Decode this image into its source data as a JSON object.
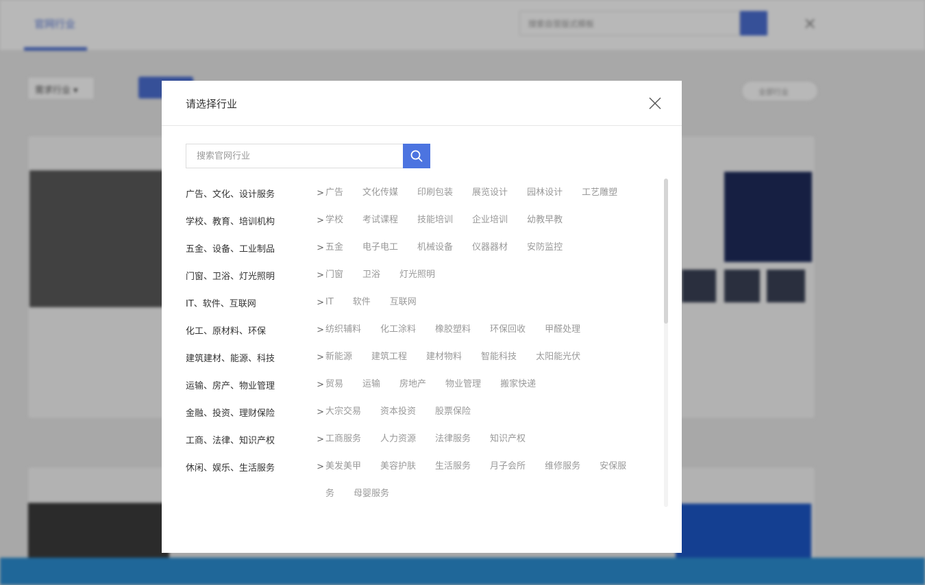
{
  "background": {
    "tab": "官网行业",
    "search_placeholder": "搜索自营版式模板",
    "filter": "需求行业 ▾",
    "pill": "全部行业"
  },
  "modal": {
    "title": "请选择行业",
    "search_placeholder": "搜索官网行业",
    "categories": [
      {
        "label": "广告、文化、设计服务",
        "items": [
          "广告",
          "文化传媒",
          "印刷包装",
          "展览设计",
          "园林设计",
          "工艺雕塑"
        ]
      },
      {
        "label": "学校、教育、培训机构",
        "items": [
          "学校",
          "考试课程",
          "技能培训",
          "企业培训",
          "幼教早教"
        ]
      },
      {
        "label": "五金、设备、工业制品",
        "items": [
          "五金",
          "电子电工",
          "机械设备",
          "仪器器材",
          "安防监控"
        ]
      },
      {
        "label": "门窗、卫浴、灯光照明",
        "items": [
          "门窗",
          "卫浴",
          "灯光照明"
        ]
      },
      {
        "label": "IT、软件、互联网",
        "items": [
          "IT",
          "软件",
          "互联网"
        ]
      },
      {
        "label": "化工、原材料、环保",
        "items": [
          "纺织辅料",
          "化工涂料",
          "橡胶塑料",
          "环保回收",
          "甲醛处理"
        ]
      },
      {
        "label": "建筑建材、能源、科技",
        "items": [
          "新能源",
          "建筑工程",
          "建材物料",
          "智能科技",
          "太阳能光伏"
        ]
      },
      {
        "label": "运输、房产、物业管理",
        "items": [
          "贸易",
          "运输",
          "房地产",
          "物业管理",
          "搬家快递"
        ]
      },
      {
        "label": "金融、投资、理财保险",
        "items": [
          "大宗交易",
          "资本投资",
          "股票保险"
        ]
      },
      {
        "label": "工商、法律、知识产权",
        "items": [
          "工商服务",
          "人力资源",
          "法律服务",
          "知识产权"
        ]
      },
      {
        "label": "休闲、娱乐、生活服务",
        "items": [
          "美发美甲",
          "美容护肤",
          "生活服务",
          "月子会所",
          "维修服务",
          "安保服",
          "务",
          "母婴服务"
        ]
      }
    ],
    "chevron": ">",
    "scroll_position": 0
  }
}
